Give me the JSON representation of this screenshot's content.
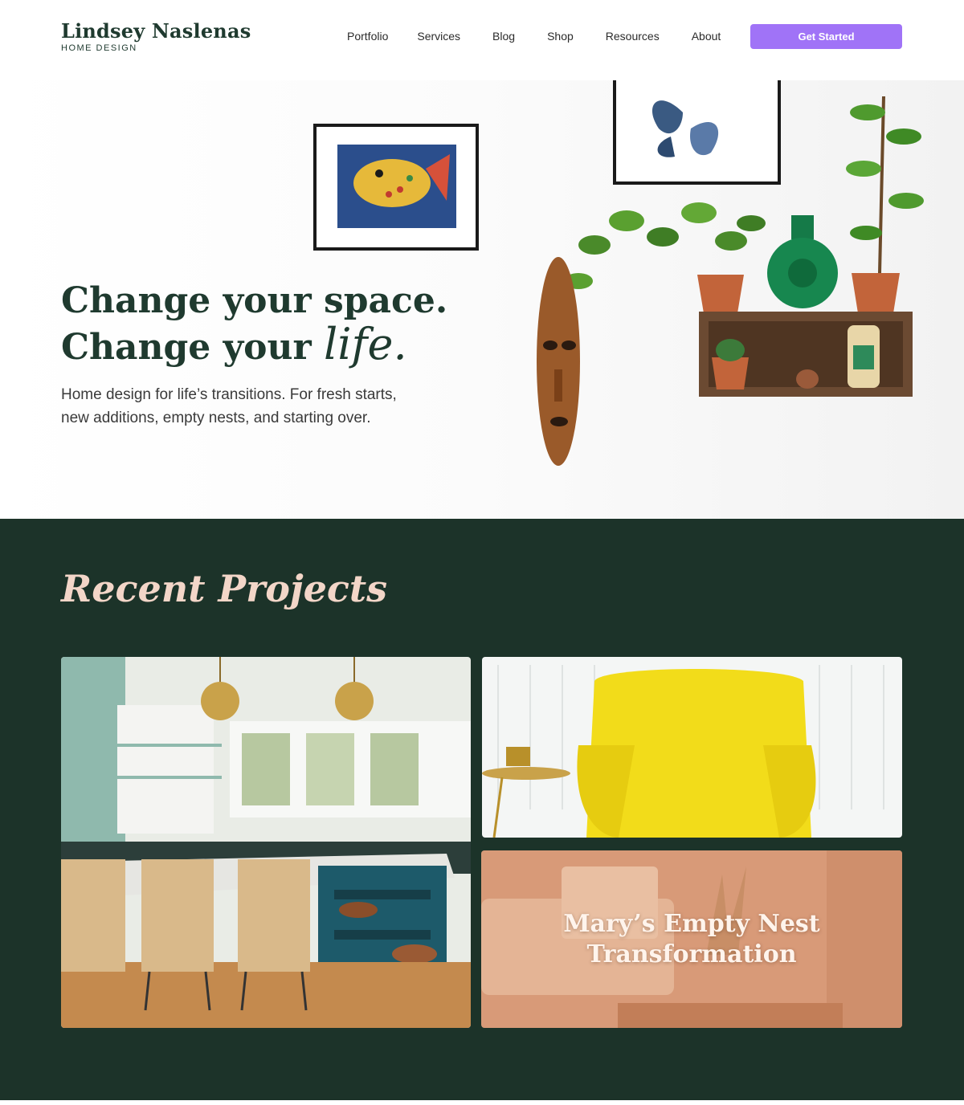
{
  "header": {
    "brand_name": "Lindsey Naslenas",
    "brand_sub": "HOME DESIGN",
    "nav": [
      "Portfolio",
      "Services",
      "Blog",
      "Shop",
      "Resources",
      "About"
    ],
    "cta_label": "Get Started"
  },
  "hero": {
    "title_line1": "Change your space.",
    "title_line2_prefix": "Change your ",
    "title_line2_script": "life.",
    "subtitle": "Home design for life’s transitions. For fresh starts, new additions, empty nests, and starting over."
  },
  "projects": {
    "title": "Recent Projects",
    "featured_caption": "Mary’s Empty Nest Transformation"
  },
  "colors": {
    "brand_green": "#1c3329",
    "accent_purple": "#a073f7",
    "script_peach": "#f3d6c8",
    "card_overlay": "#d89a78"
  }
}
